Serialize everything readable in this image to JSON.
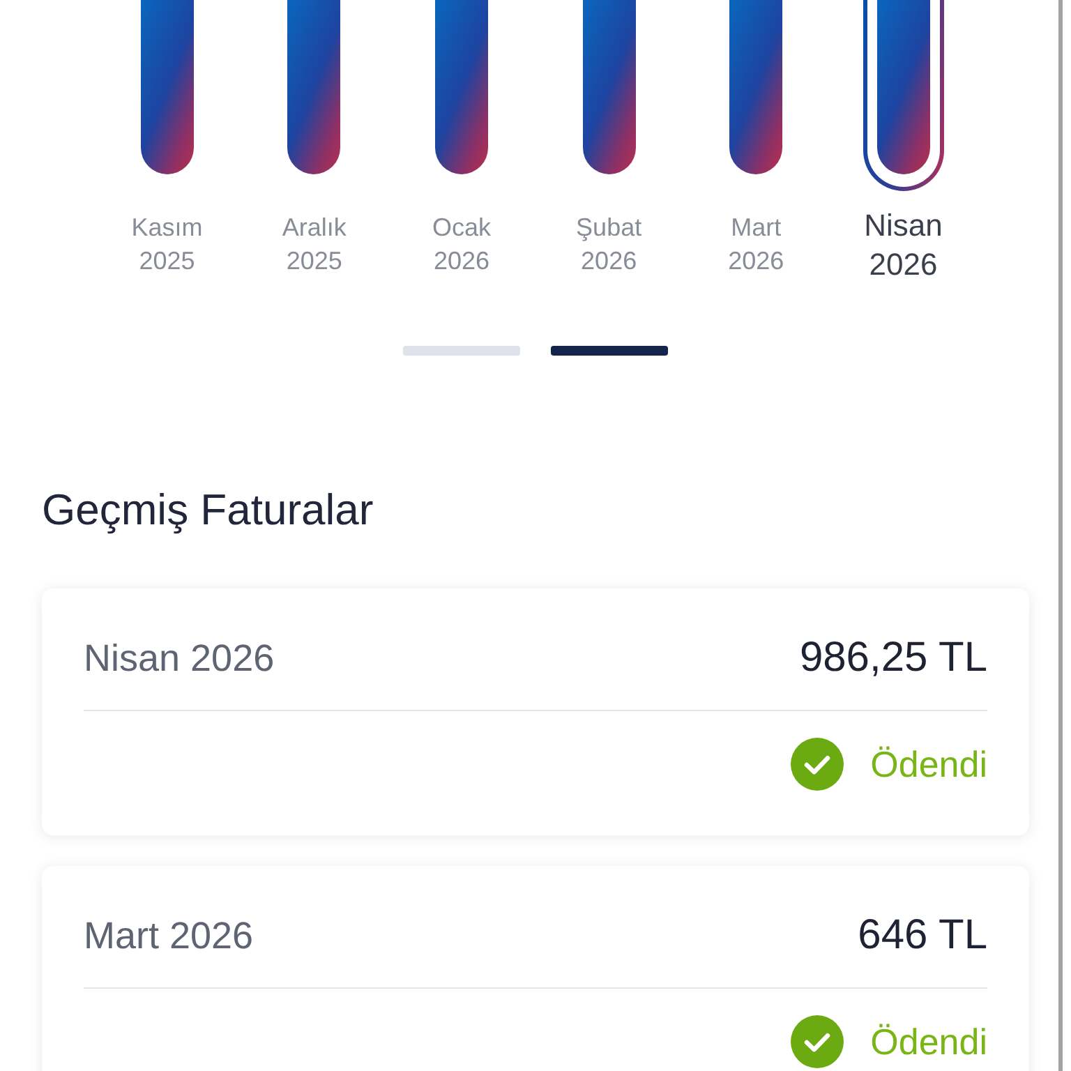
{
  "usage_chart": {
    "months": [
      {
        "month": "Kasım",
        "year": "2025",
        "selected": false
      },
      {
        "month": "Aralık",
        "year": "2025",
        "selected": false
      },
      {
        "month": "Ocak",
        "year": "2026",
        "selected": false
      },
      {
        "month": "Şubat",
        "year": "2026",
        "selected": false
      },
      {
        "month": "Mart",
        "year": "2026",
        "selected": false
      },
      {
        "month": "Nisan",
        "year": "2026",
        "selected": true
      }
    ]
  },
  "pager": [
    {
      "selected": false
    },
    {
      "selected": true
    }
  ],
  "section_title": "Geçmiş Faturalar",
  "invoices": [
    {
      "period": "Nisan 2026",
      "amount": "986,25 TL",
      "status": "Ödendi",
      "paid": true
    },
    {
      "period": "Mart 2026",
      "amount": "646 TL",
      "status": "Ödendi",
      "paid": true
    }
  ]
}
